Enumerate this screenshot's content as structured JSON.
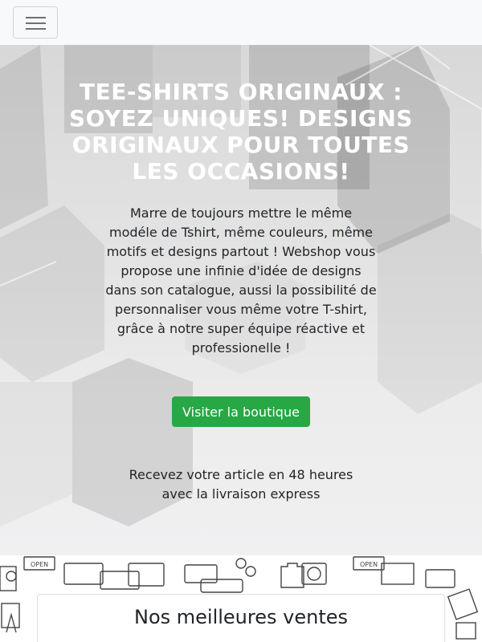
{
  "navbar": {
    "toggler_icon": "hamburger-menu-icon",
    "background": "#f8f9fa"
  },
  "hero": {
    "title": "TEE-SHIRTS ORIGINAUX : SOYEZ UNIQUES! DESIGNS ORIGINAUX POUR TOUTES LES OCCASIONS!",
    "description": "Marre de toujours mettre le même modéle de Tshirt, même couleurs, même motifs et designs partout ! Webshop vous propose une infinie d'idée de designs dans son catalogue, aussi la possibilité de personnaliser vous même votre T-shirt, grâce à notre super équipe réactive et professionelle !",
    "button_label": "Visiter la boutique",
    "delivery_note": "Recevez votre article en 48 heures avec la livraison express"
  },
  "best_sellers": {
    "title": "Nos meilleures ventes",
    "pattern_sign_text": "OPEN"
  },
  "colors": {
    "button_green": "#28a745",
    "hero_title": "#ffffff",
    "body_text": "#212529"
  }
}
